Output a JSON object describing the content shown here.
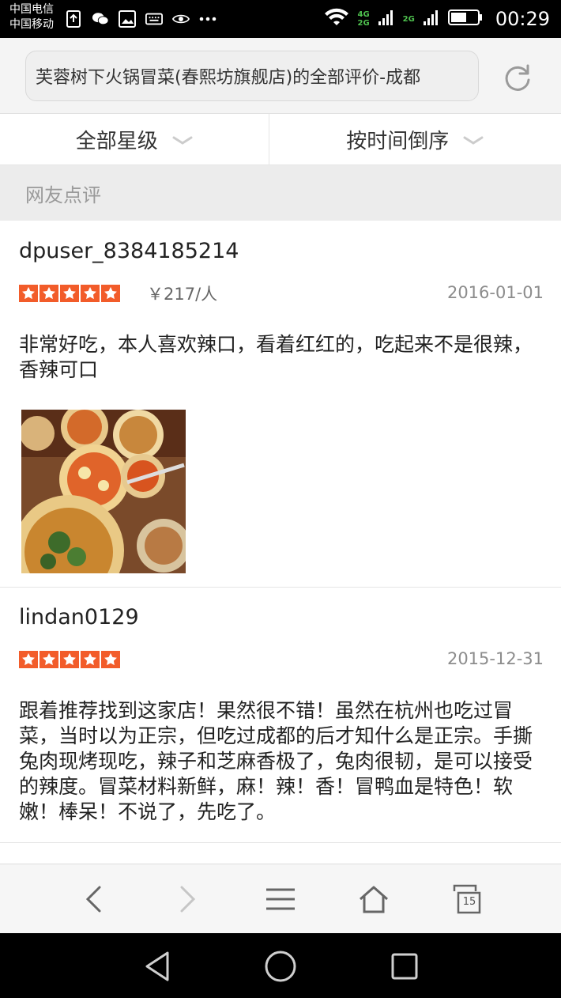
{
  "status_bar": {
    "carrier1": "中国电信",
    "carrier2": "中国移动",
    "net_top": "4G",
    "net_bottom": "2G",
    "net2": "2G",
    "time": "00:29"
  },
  "address_bar": {
    "url_text": "芙蓉树下火锅冒菜(春熙坊旗舰店)的全部评价-成都"
  },
  "filters": {
    "rating_filter": "全部星级",
    "sort_filter": "按时间倒序"
  },
  "section": {
    "title": "网友点评"
  },
  "reviews": [
    {
      "user": "dpuser_8384185214",
      "rating": 5,
      "price": "￥217/人",
      "date": "2016-01-01",
      "text": "非常好吃，本人喜欢辣口，看着红红的，吃起来不是很辣，香辣可口"
    },
    {
      "user": "lindan0129",
      "rating": 5,
      "date": "2015-12-31",
      "text": "跟着推荐找到这家店！果然很不错！虽然在杭州也吃过冒菜，当时以为正宗，但吃过成都的后才知什么是正宗。手撕兔肉现烤现吃，辣子和芝麻香极了，兔肉很韧，是可以接受的辣度。冒菜材料新鲜，麻！辣！香！冒鸭血是特色！软嫩！棒呆！不说了，先吃了。"
    }
  ],
  "toolbar": {
    "tab_count": "15"
  },
  "colors": {
    "star": "#f25c2a",
    "status_bar": "#000000",
    "section_bg": "#ececec"
  },
  "icons": [
    "back-icon",
    "forward-icon",
    "menu-icon",
    "home-icon",
    "tabs-icon",
    "refresh-icon",
    "chevron-down-icon",
    "nav-back-icon",
    "nav-home-icon",
    "nav-recents-icon"
  ]
}
